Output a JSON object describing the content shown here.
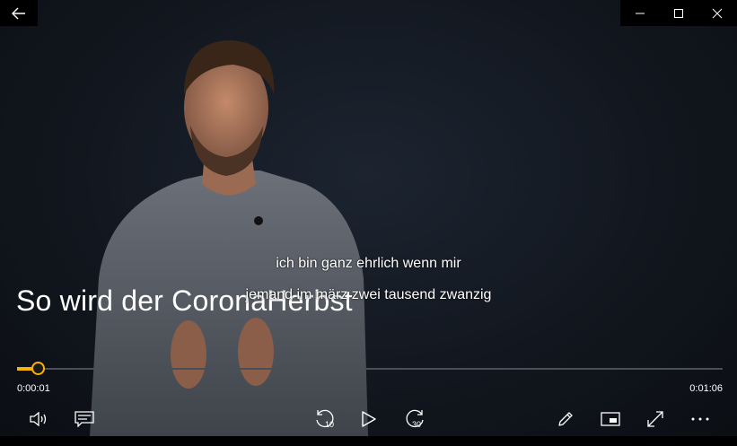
{
  "player": {
    "video_title": "So wird der CoronaHerbst",
    "subtitles": [
      "ich bin ganz ehrlich wenn mir",
      "jemand im märz zwei tausend zwanzig"
    ],
    "current_time": "0:00:01",
    "total_time": "0:01:06",
    "progress_fraction": 0.03,
    "accent_color": "#f6b20a"
  },
  "titlebar": {
    "back_icon": "arrow-left-icon",
    "minimize_icon": "minimize-icon",
    "maximize_icon": "maximize-icon",
    "close_icon": "close-icon"
  },
  "controls": {
    "volume_icon": "speaker-icon",
    "captions_icon": "captions-icon",
    "skip_back_label": "10",
    "play_icon": "play-icon",
    "skip_forward_label": "30",
    "edit_icon": "pencil-icon",
    "mini_view_icon": "mini-view-icon",
    "fullscreen_icon": "fullscreen-icon",
    "more_icon": "more-icon"
  }
}
